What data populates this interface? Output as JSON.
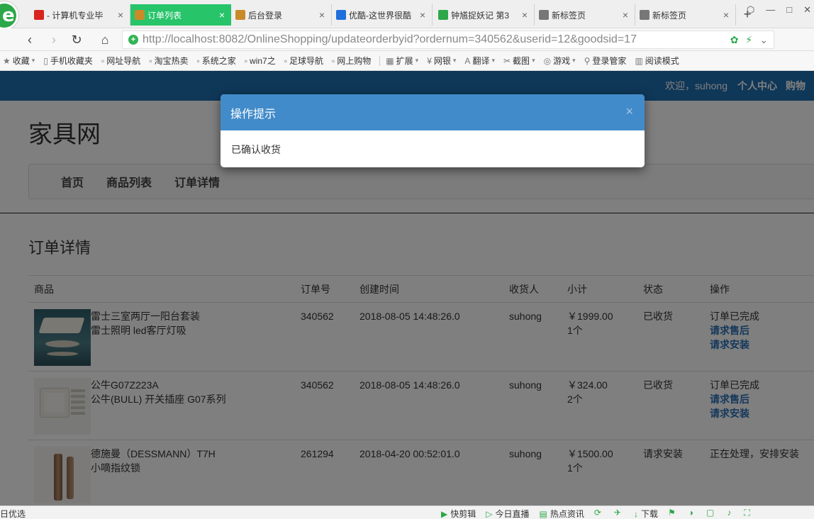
{
  "browser": {
    "tabs": [
      {
        "label": "- 计算机专业毕",
        "favicon_color": "#d9231f",
        "active": false
      },
      {
        "label": "订单列表",
        "favicon_color": "#c98b2a",
        "active": true
      },
      {
        "label": "后台登录",
        "favicon_color": "#c98b2a",
        "active": false
      },
      {
        "label": "优酷-这世界很酷",
        "favicon_color": "#1e6fdb",
        "active": false
      },
      {
        "label": "钟馗捉妖记 第3",
        "favicon_color": "#2ca74a",
        "active": false
      },
      {
        "label": "新标签页",
        "favicon_color": "#777777",
        "active": false
      },
      {
        "label": "新标签页",
        "favicon_color": "#777777",
        "active": false
      }
    ],
    "tab_close_glyph": "×",
    "new_tab_glyph": "+",
    "window_buttons": [
      "⬡",
      "—",
      "□",
      "✕"
    ],
    "nav": {
      "back": "‹",
      "forward": "›",
      "refresh": "↻",
      "home": "⌂"
    },
    "url": "http://localhost:8082/OnlineShopping/updateorderbyid?ordernum=340562&userid=12&goodsid=17",
    "url_right_icons": [
      "✿",
      "⚡",
      "⌄"
    ],
    "bookmarks": [
      {
        "label": "收藏",
        "icon": "star-icon",
        "glyph": "★",
        "caret": true
      },
      {
        "label": "手机收藏夹",
        "icon": "phone-icon",
        "glyph": "▯",
        "caret": false
      },
      {
        "label": "网址导航",
        "icon": "page-icon",
        "glyph": "▫",
        "caret": false
      },
      {
        "label": "淘宝热卖",
        "icon": "page-icon",
        "glyph": "▫",
        "caret": false
      },
      {
        "label": "系统之家",
        "icon": "page-icon",
        "glyph": "▫",
        "caret": false
      },
      {
        "label": "win7之",
        "icon": "page-icon",
        "glyph": "▫",
        "caret": false
      },
      {
        "label": "足球导航",
        "icon": "page-icon",
        "glyph": "▫",
        "caret": false
      },
      {
        "label": "网上购物",
        "icon": "page-icon",
        "glyph": "▫",
        "caret": false
      }
    ],
    "extensions": [
      {
        "label": "扩展",
        "icon": "grid-icon",
        "glyph": "▦",
        "caret": true
      },
      {
        "label": "网银",
        "icon": "bank-icon",
        "glyph": "¥",
        "caret": true
      },
      {
        "label": "翻译",
        "icon": "translate-icon",
        "glyph": "A",
        "caret": true
      },
      {
        "label": "截图",
        "icon": "scissors-icon",
        "glyph": "✂",
        "caret": true
      },
      {
        "label": "游戏",
        "icon": "gamepad-icon",
        "glyph": "◎",
        "caret": true
      },
      {
        "label": "登录管家",
        "icon": "key-icon",
        "glyph": "⚲",
        "caret": false
      },
      {
        "label": "阅读模式",
        "icon": "book-icon",
        "glyph": "▥",
        "caret": false
      }
    ]
  },
  "site": {
    "welcome": "欢迎，suhong",
    "user_center": "个人中心",
    "cart": "购物",
    "title": "家具网",
    "nav": [
      "首页",
      "商品列表",
      "订单详情"
    ],
    "section_title": "订单详情",
    "table": {
      "headers": [
        "商品",
        "订单号",
        "创建时间",
        "收货人",
        "小计",
        "状态",
        "操作"
      ],
      "rows": [
        {
          "img": "lamp",
          "name1": "雷士三室两厅一阳台套装",
          "name2": "雷士照明 led客厅灯吸",
          "ordernum": "340562",
          "created": "2018-08-05 14:48:26.0",
          "receiver": "suhong",
          "price": "￥1999.00",
          "qty": "1个",
          "status": "已收货",
          "op_text": "订单已完成",
          "op_link1": "请求售后",
          "op_link2": "请求安装"
        },
        {
          "img": "socket",
          "name1": "公牛G07Z223A",
          "name2": "公牛(BULL) 开关插座 G07系列",
          "ordernum": "340562",
          "created": "2018-08-05 14:48:26.0",
          "receiver": "suhong",
          "price": "￥324.00",
          "qty": "2个",
          "status": "已收货",
          "op_text": "订单已完成",
          "op_link1": "请求售后",
          "op_link2": "请求安装"
        },
        {
          "img": "lock",
          "name1": "德施曼（DESSMANN）T7H",
          "name2": "小嘀指纹锁",
          "ordernum": "261294",
          "created": "2018-04-20 00:52:01.0",
          "receiver": "suhong",
          "price": "￥1500.00",
          "qty": "1个",
          "status": "请求安装",
          "op_text": "正在处理，安排安装",
          "op_link1": "",
          "op_link2": ""
        }
      ]
    }
  },
  "modal": {
    "title": "操作提示",
    "close_glyph": "×",
    "message": "已确认收货"
  },
  "statusbar": {
    "left": "-日优选",
    "items": [
      {
        "label": "快剪辑",
        "glyph": "▶",
        "icon": "video-edit-icon"
      },
      {
        "label": "今日直播",
        "glyph": "▷",
        "icon": "live-icon"
      },
      {
        "label": "热点资讯",
        "glyph": "▤",
        "icon": "news-icon"
      },
      {
        "label": "",
        "glyph": "⟳",
        "icon": "speed-icon"
      },
      {
        "label": "",
        "glyph": "✈",
        "icon": "plane-icon"
      },
      {
        "label": "下载",
        "glyph": "↓",
        "icon": "download-icon"
      },
      {
        "label": "",
        "glyph": "⚑",
        "icon": "flag-icon"
      },
      {
        "label": "",
        "glyph": "◑",
        "icon": "browser-icon"
      },
      {
        "label": "",
        "glyph": "▢",
        "icon": "window-icon"
      },
      {
        "label": "",
        "glyph": "♪",
        "icon": "sound-icon"
      },
      {
        "label": "",
        "glyph": "⛶",
        "icon": "fullscreen-icon"
      }
    ]
  },
  "colors": {
    "active_tab": "#27c46a",
    "site_topbar": "#1f6fb0",
    "modal_header": "#428bca",
    "link": "#2a70b7"
  }
}
